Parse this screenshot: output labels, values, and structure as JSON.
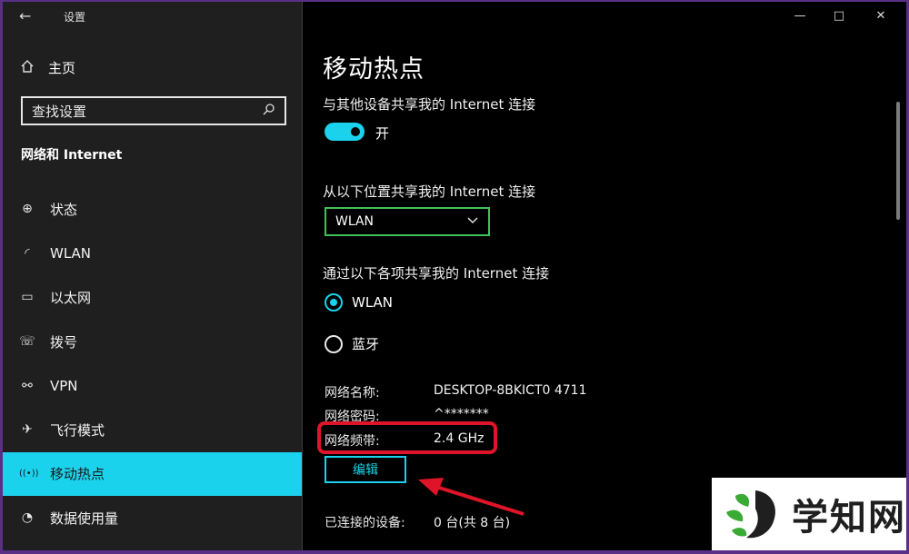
{
  "window": {
    "title": "设置",
    "back_icon": "←",
    "minimize_icon": "—",
    "maximize_icon": "□",
    "close_icon": "✕"
  },
  "sidebar": {
    "home_label": "主页",
    "search_placeholder": "查找设置",
    "section_title": "网络和 Internet",
    "items": [
      {
        "label": "状态",
        "icon": "globe-icon",
        "glyph": "⊕"
      },
      {
        "label": "WLAN",
        "icon": "wifi-icon",
        "glyph": "◜"
      },
      {
        "label": "以太网",
        "icon": "ethernet-icon",
        "glyph": "▭"
      },
      {
        "label": "拨号",
        "icon": "dialup-icon",
        "glyph": "☏"
      },
      {
        "label": "VPN",
        "icon": "vpn-icon",
        "glyph": "⚯"
      },
      {
        "label": "飞行模式",
        "icon": "airplane-icon",
        "glyph": "✈"
      },
      {
        "label": "移动热点",
        "icon": "hotspot-icon",
        "glyph": "((•))"
      },
      {
        "label": "数据使用量",
        "icon": "data-usage-icon",
        "glyph": "◔"
      }
    ],
    "active_index": 6
  },
  "main": {
    "title": "移动热点",
    "share_label": "与其他设备共享我的 Internet 连接",
    "toggle_state": "开",
    "share_from_label": "从以下位置共享我的 Internet 连接",
    "share_from_value": "WLAN",
    "share_over_label": "通过以下各项共享我的 Internet 连接",
    "radio_options": [
      {
        "label": "WLAN",
        "checked": true
      },
      {
        "label": "蓝牙",
        "checked": false
      }
    ],
    "network_name_label": "网络名称:",
    "network_name_value": "DESKTOP-8BKICT0 4711",
    "network_password_label": "网络密码:",
    "network_password_value": "^*******",
    "network_band_label": "网络频带:",
    "network_band_value": "2.4 GHz",
    "edit_label": "编辑",
    "connected_label": "已连接的设备:",
    "connected_value": "0 台(共 8 台)"
  },
  "watermark": {
    "text": "学知网"
  },
  "colors": {
    "accent": "#1bd2ec",
    "highlight_red": "#e01428",
    "dropdown_border": "#42c05a"
  }
}
